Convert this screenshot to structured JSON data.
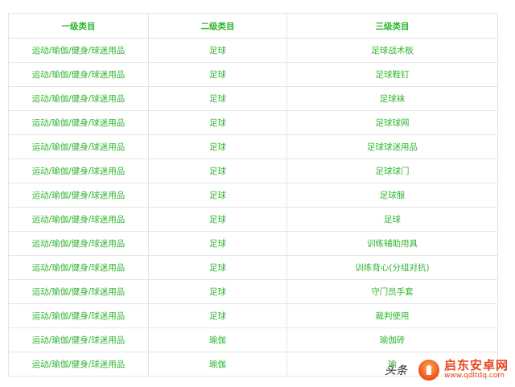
{
  "table": {
    "headers": [
      "一级类目",
      "二级类目",
      "三级类目"
    ],
    "rows": [
      [
        "运动/瑜伽/健身/球迷用品",
        "足球",
        "足球战术板"
      ],
      [
        "运动/瑜伽/健身/球迷用品",
        "足球",
        "足球鞋钉"
      ],
      [
        "运动/瑜伽/健身/球迷用品",
        "足球",
        "足球袜"
      ],
      [
        "运动/瑜伽/健身/球迷用品",
        "足球",
        "足球球网"
      ],
      [
        "运动/瑜伽/健身/球迷用品",
        "足球",
        "足球球迷用品"
      ],
      [
        "运动/瑜伽/健身/球迷用品",
        "足球",
        "足球球门"
      ],
      [
        "运动/瑜伽/健身/球迷用品",
        "足球",
        "足球服"
      ],
      [
        "运动/瑜伽/健身/球迷用品",
        "足球",
        "足球"
      ],
      [
        "运动/瑜伽/健身/球迷用品",
        "足球",
        "训练辅助用具"
      ],
      [
        "运动/瑜伽/健身/球迷用品",
        "足球",
        "训练背心(分组对抗)"
      ],
      [
        "运动/瑜伽/健身/球迷用品",
        "足球",
        "守门员手套"
      ],
      [
        "运动/瑜伽/健身/球迷用品",
        "足球",
        "裁判使用"
      ],
      [
        "运动/瑜伽/健身/球迷用品",
        "瑜伽",
        "瑜伽砖"
      ],
      [
        "运动/瑜伽/健身/球迷用品",
        "瑜伽",
        "瑜"
      ]
    ]
  },
  "watermark": {
    "toutiao": "头条",
    "site_name": "启东安卓网",
    "site_url": "www.qdltdq.com",
    "logo_icon": "flame-logo-icon"
  },
  "colors": {
    "text_green": "#2fb52f",
    "border": "#e5e5e5",
    "watermark_orange": "#e6461d"
  }
}
